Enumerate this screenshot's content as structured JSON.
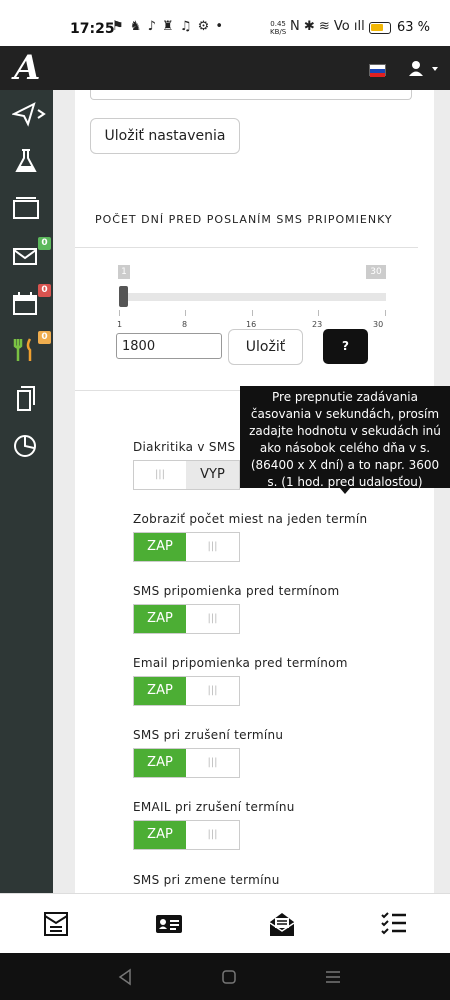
{
  "status_bar": {
    "time": "17:25",
    "icons": "⚑ ♞ ♪ ♜ ♫ ⚙ •",
    "net_speed": "0.45\nKB/S",
    "signal_icons": "N ✱ ≋ Vo ıll",
    "battery_percent": "63 %"
  },
  "header": {
    "logo_text": "A",
    "language": "sk",
    "user_menu": "user"
  },
  "sidebar": {
    "items": [
      {
        "icon": "send-icon"
      },
      {
        "icon": "flask-icon"
      },
      {
        "icon": "folder-icon"
      },
      {
        "icon": "mail-icon",
        "badge": "0",
        "badge_color": "#5cb85c"
      },
      {
        "icon": "calendar-icon",
        "badge": "0",
        "badge_color": "#d9534f"
      },
      {
        "icon": "food-icon",
        "badge": "0",
        "badge_color": "#f0ad4e"
      },
      {
        "icon": "document-icon"
      },
      {
        "icon": "pie-chart-icon"
      }
    ]
  },
  "main": {
    "save_settings_label": "Uložiť nastavenia",
    "sms_days_section": {
      "title": "POČET DNÍ PRED POSLANÍM SMS PRIPOMIENKY",
      "slider": {
        "min_tag": "1",
        "max_tag": "30",
        "value_fraction": 0.0,
        "ticks": [
          "1",
          "8",
          "16",
          "23",
          "30"
        ]
      },
      "input_value": "1800",
      "save_label": "Uložiť",
      "help_label": "?",
      "tooltip": "Pre prepnutie zadávania časovania v sekundách, prosím zadajte hodnotu v sekudách inú ako násobok celého dňa v s. (86400 x X dní) a to napr. 3600 s. (1 hod. pred udalosťou)"
    },
    "options": [
      {
        "label": "Diakritika v SMS",
        "state": "VYP",
        "on_text": "ZAP",
        "off_text": "VYP",
        "handle": "|||"
      },
      {
        "label": "Zobraziť počet miest na jeden termín",
        "state": "ZAP",
        "on_text": "ZAP",
        "handle": "|||"
      },
      {
        "label": "SMS pripomienka pred termínom",
        "state": "ZAP",
        "on_text": "ZAP",
        "handle": "|||"
      },
      {
        "label": "Email pripomienka pred termínom",
        "state": "ZAP",
        "on_text": "ZAP",
        "handle": "|||"
      },
      {
        "label": "SMS pri zrušení termínu",
        "state": "ZAP",
        "on_text": "ZAP",
        "handle": "|||"
      },
      {
        "label": "EMAIL pri zrušení termínu",
        "state": "ZAP",
        "on_text": "ZAP",
        "handle": "|||"
      },
      {
        "label": "SMS pri zmene termínu"
      }
    ]
  },
  "bottom_nav": {
    "items": [
      {
        "icon": "newsletter-icon"
      },
      {
        "icon": "contact-card-icon"
      },
      {
        "icon": "mail-open-icon"
      },
      {
        "icon": "checklist-icon"
      }
    ]
  },
  "colors": {
    "toggle_on": "#4cae34",
    "topbar": "#222222",
    "sidebar": "#2e3736"
  }
}
